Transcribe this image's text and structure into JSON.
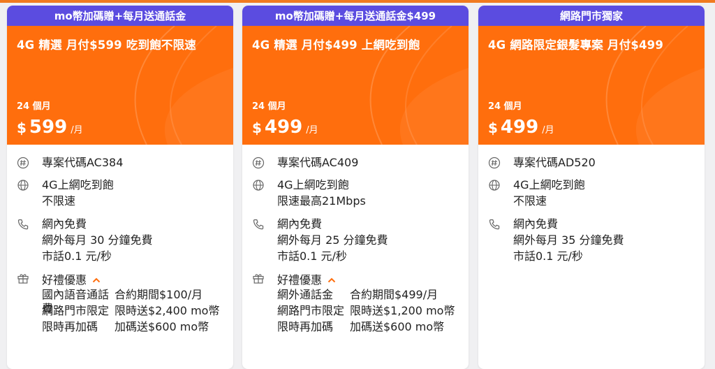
{
  "colors": {
    "accent": "#ff6e0d",
    "ribbon": "#5b4ce0",
    "icon": "#666666",
    "chevron": "#ff6e0d"
  },
  "cards": [
    {
      "ribbon": "mo幣加碼贈+每月送通話金",
      "title": "4G 精選 月付$599 吃到飽不限速",
      "months": "24 個月",
      "currency": "$",
      "amount": "599",
      "per": "/月",
      "code": "專案代碼AC384",
      "net": [
        "4G上網吃到飽",
        "不限速"
      ],
      "call": [
        "網內免費",
        "網外每月 30 分鐘免費",
        "市話0.1 元/秒"
      ],
      "gift_title": "好禮優惠",
      "gifts": [
        [
          "國內語音通話費",
          "合約期間$100/月"
        ],
        [
          "網路門市限定",
          "限時送$2,400 mo幣"
        ],
        [
          "限時再加碼",
          "加碼送$600 mo幣"
        ]
      ]
    },
    {
      "ribbon": "mo幣加碼贈+每月送通話金$499",
      "title": "4G 精選 月付$499 上網吃到飽",
      "months": "24 個月",
      "currency": "$",
      "amount": "499",
      "per": "/月",
      "code": "專案代碼AC409",
      "net": [
        "4G上網吃到飽",
        "限速最高21Mbps"
      ],
      "call": [
        "網內免費",
        "網外每月 25 分鐘免費",
        "市話0.1 元/秒"
      ],
      "gift_title": "好禮優惠",
      "gifts": [
        [
          "網外通話金",
          "合約期間$499/月"
        ],
        [
          "網路門市限定",
          "限時送$1,200 mo幣"
        ],
        [
          "限時再加碼",
          "加碼送$600 mo幣"
        ]
      ]
    },
    {
      "ribbon": "網路門市獨家",
      "title": "4G 網路限定銀髮專案 月付$499",
      "months": "24 個月",
      "currency": "$",
      "amount": "499",
      "per": "/月",
      "code": "專案代碼AD520",
      "net": [
        "4G上網吃到飽",
        "不限速"
      ],
      "call": [
        "網內免費",
        "網外每月 35 分鐘免費",
        "市話0.1 元/秒"
      ]
    }
  ]
}
